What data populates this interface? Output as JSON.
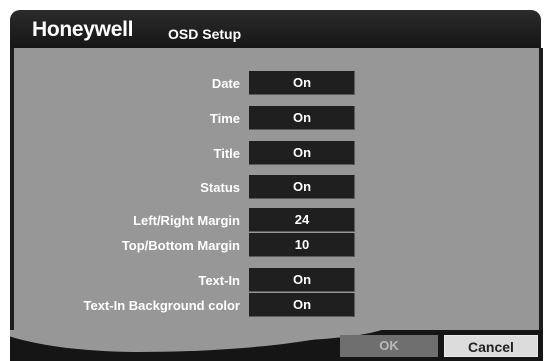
{
  "header": {
    "brand": "Honeywell",
    "title": "OSD Setup"
  },
  "settings": [
    {
      "label": "Date",
      "value": "On"
    },
    {
      "label": "Time",
      "value": "On"
    },
    {
      "label": "Title",
      "value": "On"
    },
    {
      "label": "Status",
      "value": "On"
    },
    {
      "label": "Left/Right Margin",
      "value": "24"
    },
    {
      "label": "Top/Bottom Margin",
      "value": "10"
    },
    {
      "label": "Text-In",
      "value": "On"
    },
    {
      "label": "Text-In Background color",
      "value": "On"
    }
  ],
  "buttons": {
    "ok": "OK",
    "cancel": "Cancel"
  }
}
